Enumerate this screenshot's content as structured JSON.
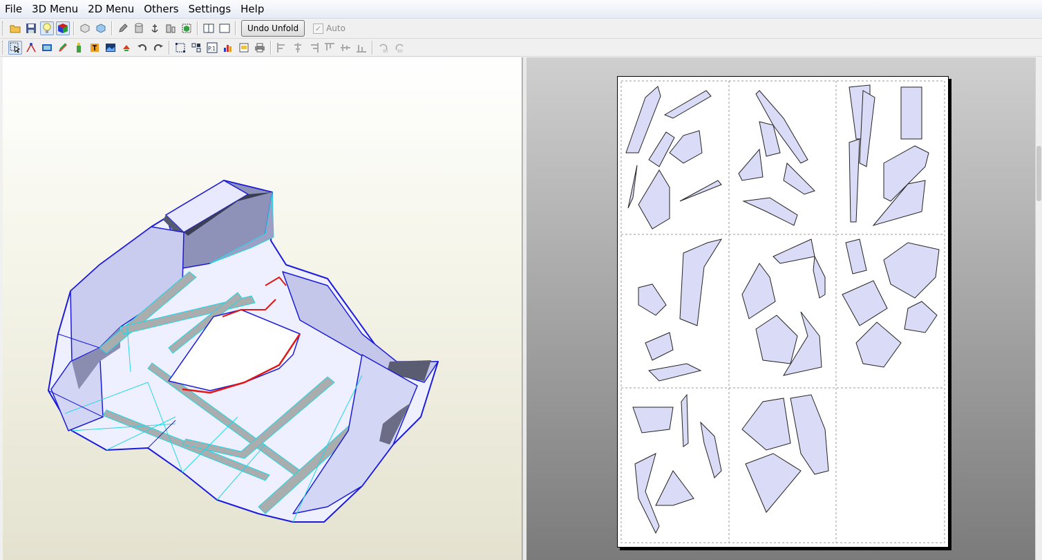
{
  "menu": [
    "File",
    "3D Menu",
    "2D Menu",
    "Others",
    "Settings",
    "Help"
  ],
  "toolbar1": {
    "icons": [
      "open-folder-icon",
      "save-icon",
      "light-bulb-icon",
      "color-cube-icon",
      "box-3d-icon",
      "box-texture-icon",
      "pencil-icon",
      "cylinder-icon",
      "anchor-icon",
      "part-split-icon",
      "cube-join-icon",
      "window-single-icon",
      "window-double-icon"
    ],
    "undo_label": "Undo Unfold",
    "auto_label": "Auto",
    "auto_checked": true
  },
  "toolbar2": {
    "icons": [
      "select-arrow-icon",
      "edge-join-icon",
      "film-icon",
      "ruler-icon",
      "bottle-icon",
      "text-tool-icon",
      "image-tool-icon",
      "move-part-icon",
      "undo-rotate-icon",
      "redo-rotate-icon",
      "frame-select-icon",
      "group-icon",
      "page-number-icon",
      "bar-chart-icon",
      "page-setup-icon",
      "print-icon",
      "align-left-icon",
      "align-center-icon",
      "align-right-icon",
      "align-top-icon",
      "align-middle-icon",
      "align-bottom-icon",
      "rotate-90-ccw-icon",
      "rotate-90-cw-icon"
    ],
    "rotate_labels": [
      "90",
      "90"
    ]
  },
  "colors": {
    "face": "#d9dbf7",
    "edge_blue": "#1a1ad8",
    "edge_cyan": "#22d6e6",
    "edge_red": "#e01818",
    "dark_face": "#5a5d72"
  }
}
